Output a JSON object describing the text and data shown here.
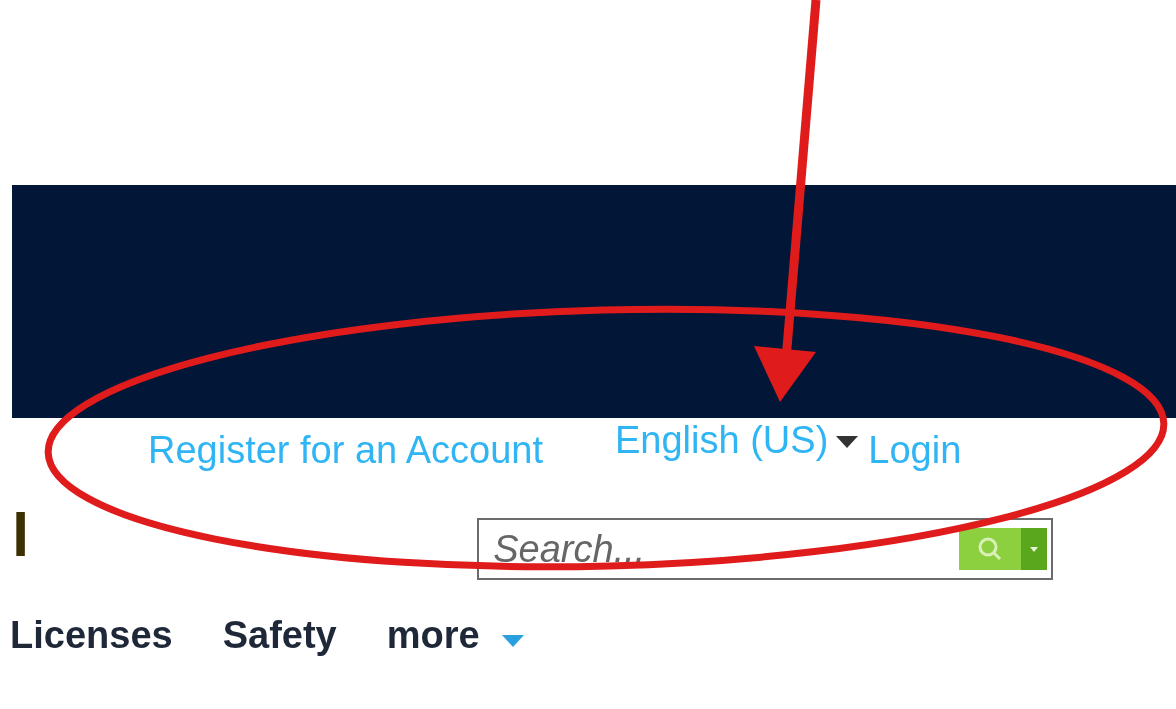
{
  "header_links": [
    {
      "kind": "link",
      "label": "Register for an Account"
    },
    {
      "kind": "dropdown",
      "label": "English (US)"
    },
    {
      "kind": "link",
      "label": "Login"
    }
  ],
  "logo_text": "l",
  "search": {
    "placeholder": "Search..."
  },
  "nav": [
    {
      "label": "Licenses",
      "has_menu": false
    },
    {
      "label": "Safety",
      "has_menu": false
    },
    {
      "label": "more",
      "has_menu": true
    }
  ]
}
